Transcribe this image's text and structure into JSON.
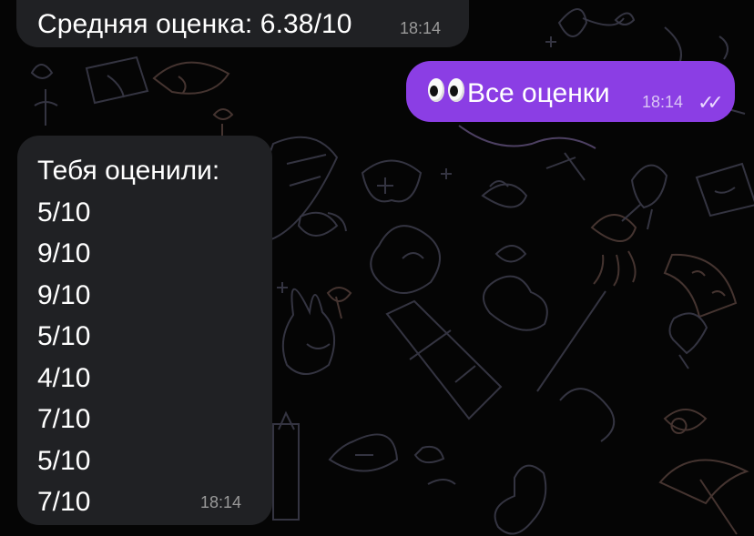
{
  "messages": [
    {
      "direction": "incoming",
      "text": "Средняя оценка: 6.38/10",
      "time": "18:14"
    },
    {
      "direction": "outgoing",
      "emoji": "eyes-emoji",
      "text": "Все оценки",
      "time": "18:14",
      "status": "read",
      "status_icon": "double-check-icon"
    },
    {
      "direction": "incoming",
      "title": "Тебя оценили:",
      "scores": [
        "5/10",
        "9/10",
        "9/10",
        "5/10",
        "4/10",
        "7/10",
        "5/10",
        "7/10"
      ],
      "time": "18:14"
    }
  ],
  "colors": {
    "background": "#050505",
    "incoming_bubble": "#202124",
    "outgoing_bubble": "#8b3ee4",
    "text": "#ffffff",
    "incoming_time": "#9a9a9a",
    "outgoing_time": "#dbc6f5",
    "wallpaper_lines": "#3a3a48"
  }
}
